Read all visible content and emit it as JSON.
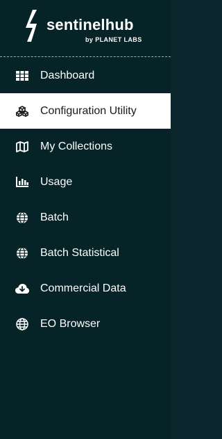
{
  "brand": {
    "name": "sentinelhub",
    "sub": "by PLANET LABS"
  },
  "nav": {
    "items": [
      {
        "label": "Dashboard",
        "icon": "grid-icon"
      },
      {
        "label": "Configuration Utility",
        "icon": "cubes-icon",
        "active": true
      },
      {
        "label": "My Collections",
        "icon": "map-icon"
      },
      {
        "label": "Usage",
        "icon": "bar-chart-icon"
      },
      {
        "label": "Batch",
        "icon": "globe-icon"
      },
      {
        "label": "Batch Statistical",
        "icon": "globe-icon"
      },
      {
        "label": "Commercial Data",
        "icon": "cloud-download-icon"
      },
      {
        "label": "EO Browser",
        "icon": "globe-outline-icon"
      }
    ]
  },
  "colors": {
    "background": "#062328",
    "active_bg": "#ffffff",
    "text": "#ffffff",
    "active_text": "#1a1a1a"
  }
}
